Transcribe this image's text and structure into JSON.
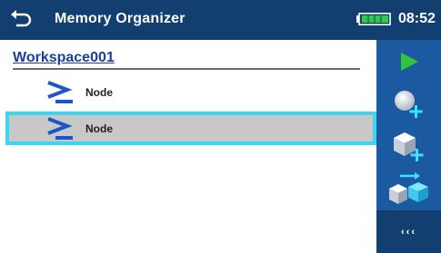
{
  "header": {
    "title": "Memory Organizer",
    "time": "08:52"
  },
  "workspace": {
    "name": "Workspace001"
  },
  "tree": {
    "items": [
      {
        "label": "Node",
        "selected": false
      },
      {
        "label": "Node",
        "selected": true
      }
    ]
  },
  "toolbar": {
    "items": [
      {
        "icon": "play-icon"
      },
      {
        "icon": "add-circle-icon"
      },
      {
        "icon": "add-cube-icon"
      },
      {
        "icon": "move-cubes-icon"
      },
      {
        "icon": "more-options-icon",
        "label": "‹‹‹"
      }
    ]
  },
  "colors": {
    "header_bg": "#123f6f",
    "toolbar_bg": "#1b5aa0",
    "selection_border": "#3dd6f0",
    "selection_fill": "#c8c8c8",
    "workspace_text": "#1d3f9a",
    "accent_green": "#33c43a"
  }
}
